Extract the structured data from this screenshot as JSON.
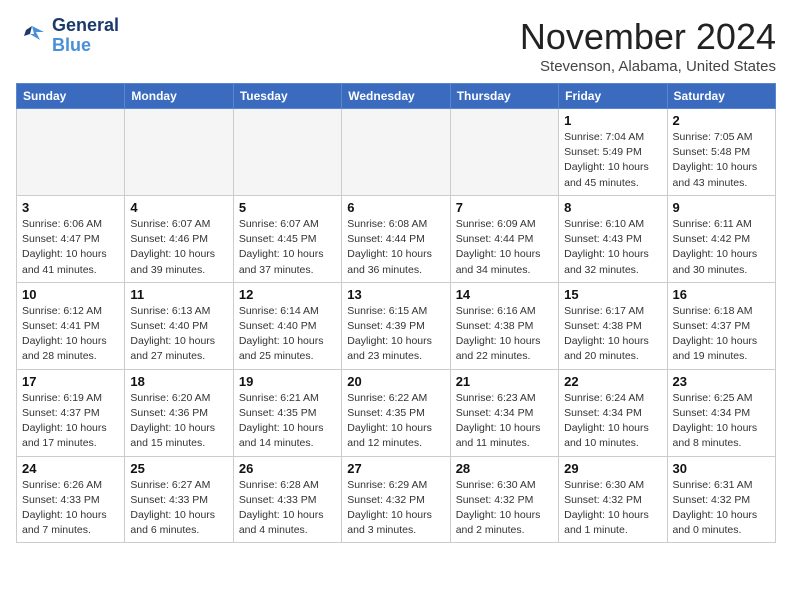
{
  "header": {
    "logo_line1": "General",
    "logo_line2": "Blue",
    "month": "November 2024",
    "location": "Stevenson, Alabama, United States"
  },
  "days_of_week": [
    "Sunday",
    "Monday",
    "Tuesday",
    "Wednesday",
    "Thursday",
    "Friday",
    "Saturday"
  ],
  "weeks": [
    [
      {
        "day": "",
        "info": ""
      },
      {
        "day": "",
        "info": ""
      },
      {
        "day": "",
        "info": ""
      },
      {
        "day": "",
        "info": ""
      },
      {
        "day": "",
        "info": ""
      },
      {
        "day": "1",
        "info": "Sunrise: 7:04 AM\nSunset: 5:49 PM\nDaylight: 10 hours\nand 45 minutes."
      },
      {
        "day": "2",
        "info": "Sunrise: 7:05 AM\nSunset: 5:48 PM\nDaylight: 10 hours\nand 43 minutes."
      }
    ],
    [
      {
        "day": "3",
        "info": "Sunrise: 6:06 AM\nSunset: 4:47 PM\nDaylight: 10 hours\nand 41 minutes."
      },
      {
        "day": "4",
        "info": "Sunrise: 6:07 AM\nSunset: 4:46 PM\nDaylight: 10 hours\nand 39 minutes."
      },
      {
        "day": "5",
        "info": "Sunrise: 6:07 AM\nSunset: 4:45 PM\nDaylight: 10 hours\nand 37 minutes."
      },
      {
        "day": "6",
        "info": "Sunrise: 6:08 AM\nSunset: 4:44 PM\nDaylight: 10 hours\nand 36 minutes."
      },
      {
        "day": "7",
        "info": "Sunrise: 6:09 AM\nSunset: 4:44 PM\nDaylight: 10 hours\nand 34 minutes."
      },
      {
        "day": "8",
        "info": "Sunrise: 6:10 AM\nSunset: 4:43 PM\nDaylight: 10 hours\nand 32 minutes."
      },
      {
        "day": "9",
        "info": "Sunrise: 6:11 AM\nSunset: 4:42 PM\nDaylight: 10 hours\nand 30 minutes."
      }
    ],
    [
      {
        "day": "10",
        "info": "Sunrise: 6:12 AM\nSunset: 4:41 PM\nDaylight: 10 hours\nand 28 minutes."
      },
      {
        "day": "11",
        "info": "Sunrise: 6:13 AM\nSunset: 4:40 PM\nDaylight: 10 hours\nand 27 minutes."
      },
      {
        "day": "12",
        "info": "Sunrise: 6:14 AM\nSunset: 4:40 PM\nDaylight: 10 hours\nand 25 minutes."
      },
      {
        "day": "13",
        "info": "Sunrise: 6:15 AM\nSunset: 4:39 PM\nDaylight: 10 hours\nand 23 minutes."
      },
      {
        "day": "14",
        "info": "Sunrise: 6:16 AM\nSunset: 4:38 PM\nDaylight: 10 hours\nand 22 minutes."
      },
      {
        "day": "15",
        "info": "Sunrise: 6:17 AM\nSunset: 4:38 PM\nDaylight: 10 hours\nand 20 minutes."
      },
      {
        "day": "16",
        "info": "Sunrise: 6:18 AM\nSunset: 4:37 PM\nDaylight: 10 hours\nand 19 minutes."
      }
    ],
    [
      {
        "day": "17",
        "info": "Sunrise: 6:19 AM\nSunset: 4:37 PM\nDaylight: 10 hours\nand 17 minutes."
      },
      {
        "day": "18",
        "info": "Sunrise: 6:20 AM\nSunset: 4:36 PM\nDaylight: 10 hours\nand 15 minutes."
      },
      {
        "day": "19",
        "info": "Sunrise: 6:21 AM\nSunset: 4:35 PM\nDaylight: 10 hours\nand 14 minutes."
      },
      {
        "day": "20",
        "info": "Sunrise: 6:22 AM\nSunset: 4:35 PM\nDaylight: 10 hours\nand 12 minutes."
      },
      {
        "day": "21",
        "info": "Sunrise: 6:23 AM\nSunset: 4:34 PM\nDaylight: 10 hours\nand 11 minutes."
      },
      {
        "day": "22",
        "info": "Sunrise: 6:24 AM\nSunset: 4:34 PM\nDaylight: 10 hours\nand 10 minutes."
      },
      {
        "day": "23",
        "info": "Sunrise: 6:25 AM\nSunset: 4:34 PM\nDaylight: 10 hours\nand 8 minutes."
      }
    ],
    [
      {
        "day": "24",
        "info": "Sunrise: 6:26 AM\nSunset: 4:33 PM\nDaylight: 10 hours\nand 7 minutes."
      },
      {
        "day": "25",
        "info": "Sunrise: 6:27 AM\nSunset: 4:33 PM\nDaylight: 10 hours\nand 6 minutes."
      },
      {
        "day": "26",
        "info": "Sunrise: 6:28 AM\nSunset: 4:33 PM\nDaylight: 10 hours\nand 4 minutes."
      },
      {
        "day": "27",
        "info": "Sunrise: 6:29 AM\nSunset: 4:32 PM\nDaylight: 10 hours\nand 3 minutes."
      },
      {
        "day": "28",
        "info": "Sunrise: 6:30 AM\nSunset: 4:32 PM\nDaylight: 10 hours\nand 2 minutes."
      },
      {
        "day": "29",
        "info": "Sunrise: 6:30 AM\nSunset: 4:32 PM\nDaylight: 10 hours\nand 1 minute."
      },
      {
        "day": "30",
        "info": "Sunrise: 6:31 AM\nSunset: 4:32 PM\nDaylight: 10 hours\nand 0 minutes."
      }
    ]
  ]
}
